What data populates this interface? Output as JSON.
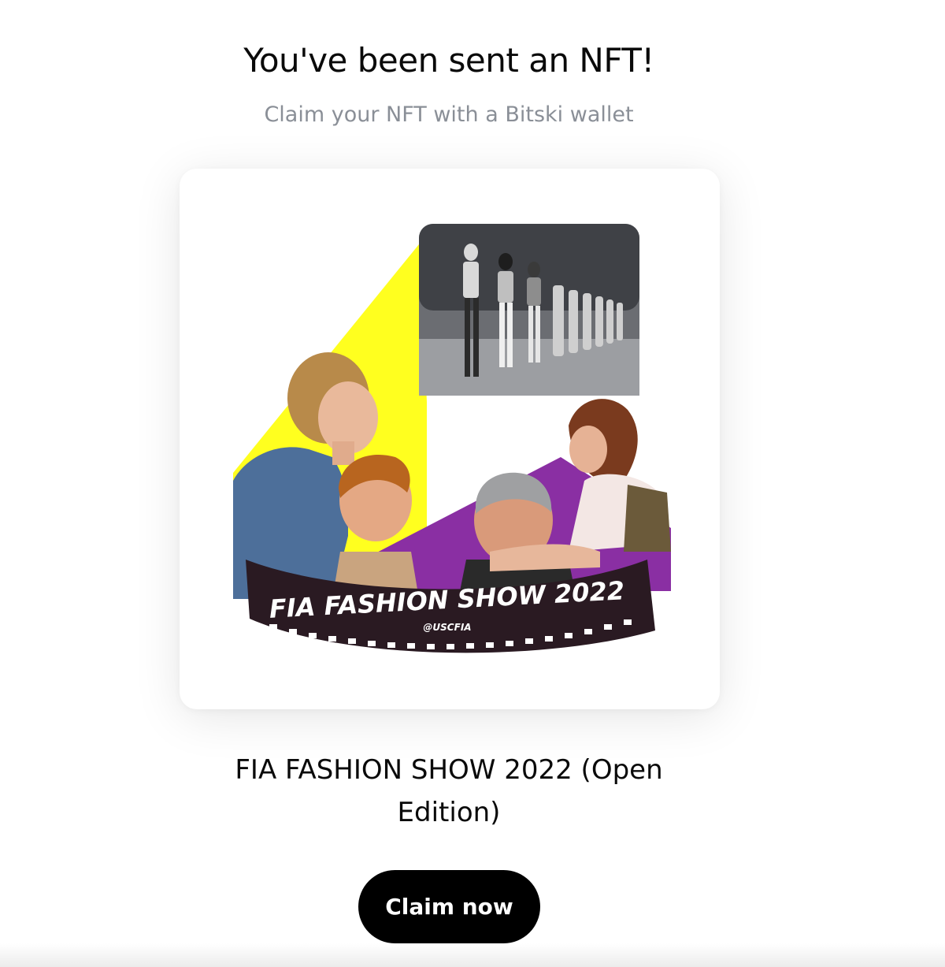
{
  "header": {
    "title": "You've been sent an NFT!",
    "subtitle": "Claim your NFT with a Bitski wallet"
  },
  "nft": {
    "name": "FIA FASHION SHOW 2022 (Open Edition)",
    "image": {
      "description_icon": "nft-artwork",
      "banner_text": "FIA FASHION SHOW 2022",
      "handle_text": "@USCFIA",
      "colors": {
        "yellow": "#ffff1f",
        "purple": "#8a2fa3",
        "banner": "#2a1a22"
      }
    }
  },
  "actions": {
    "claim_label": "Claim now"
  }
}
